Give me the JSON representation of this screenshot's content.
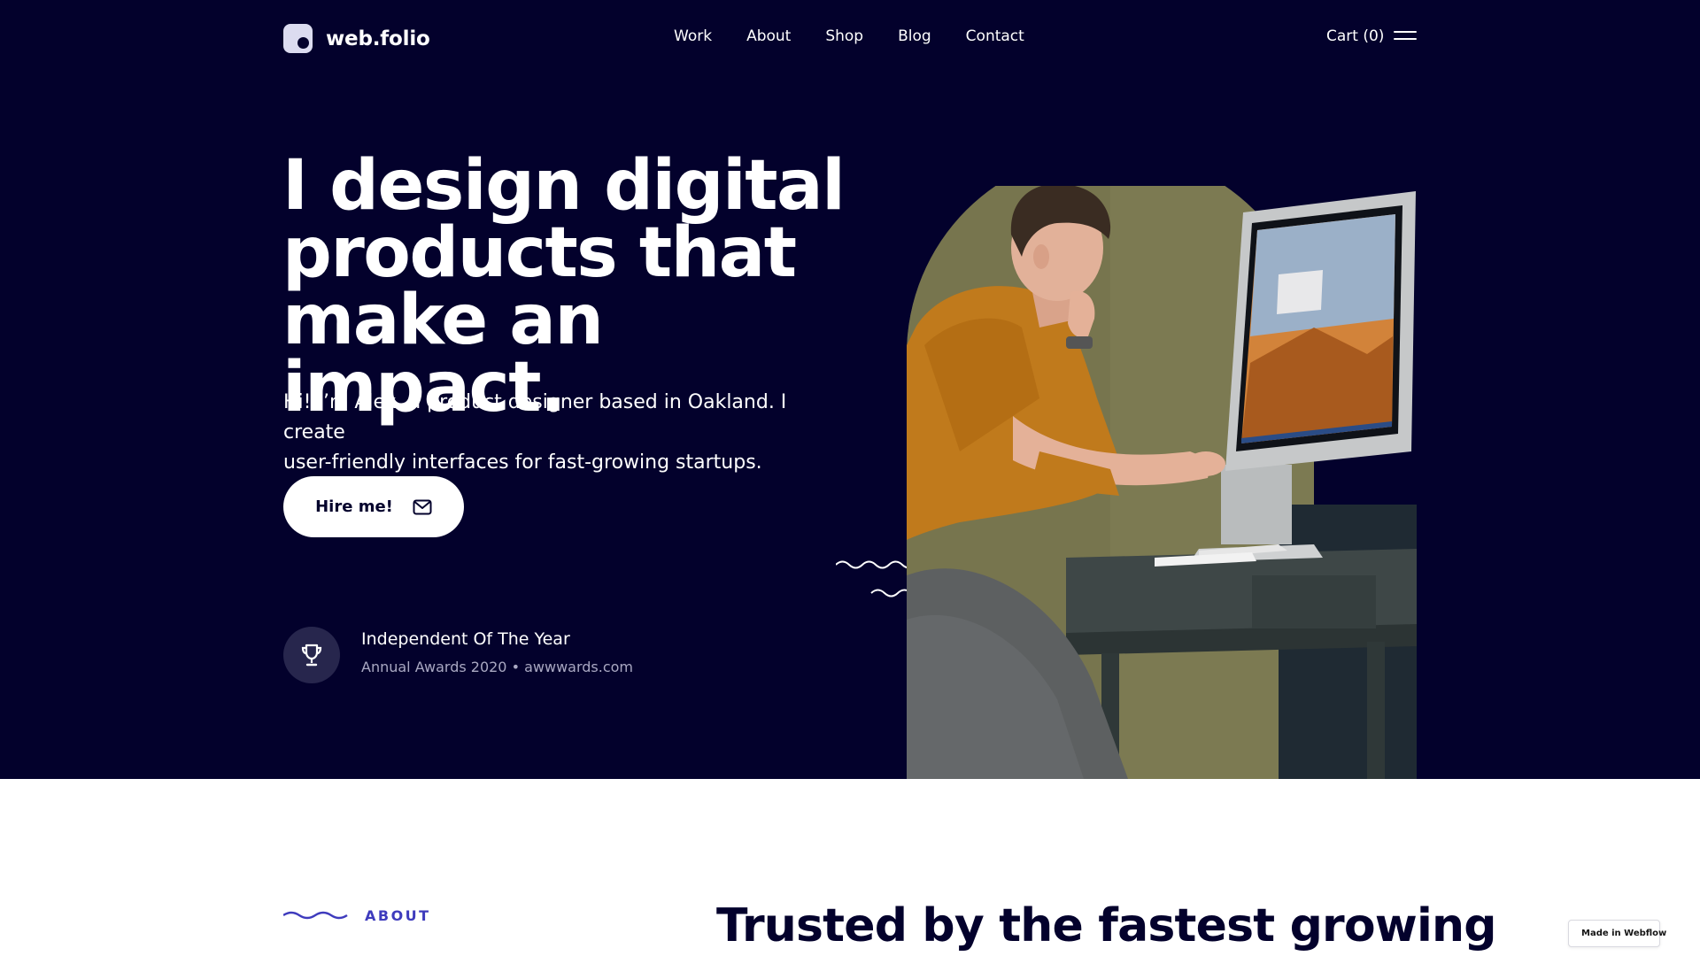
{
  "brand": {
    "name": "web.folio"
  },
  "nav": {
    "items": [
      {
        "label": "Work"
      },
      {
        "label": "About"
      },
      {
        "label": "Shop"
      },
      {
        "label": "Blog"
      },
      {
        "label": "Contact"
      }
    ],
    "cart_label": "Cart (0)"
  },
  "hero": {
    "headline_lines": [
      "I design digital",
      "products that",
      "make an impact."
    ],
    "intro_lines": [
      "Hi! I’m Alex, a product designer based in Oakland. I create",
      "user-friendly interfaces for fast-growing startups."
    ],
    "cta_label": "Hire me!",
    "award": {
      "title": "Independent Of The Year",
      "subtitle": "Annual Awards 2020 • awwwards.com"
    }
  },
  "about": {
    "label": "ABOUT",
    "heading": "Trusted by the fastest growing"
  },
  "badge": {
    "label": "Made in Webflow"
  },
  "colors": {
    "hero_bg": "#03012c",
    "accent": "#3e3bbd",
    "photo_circle": "#7c7a52",
    "shirt": "#c07a1c"
  },
  "icons": {
    "logo": "logo-mark-icon",
    "menu": "hamburger-menu-icon",
    "mail": "mail-icon",
    "award": "trophy-icon",
    "about": "wave-icon",
    "webflow": "webflow-logo-icon"
  }
}
